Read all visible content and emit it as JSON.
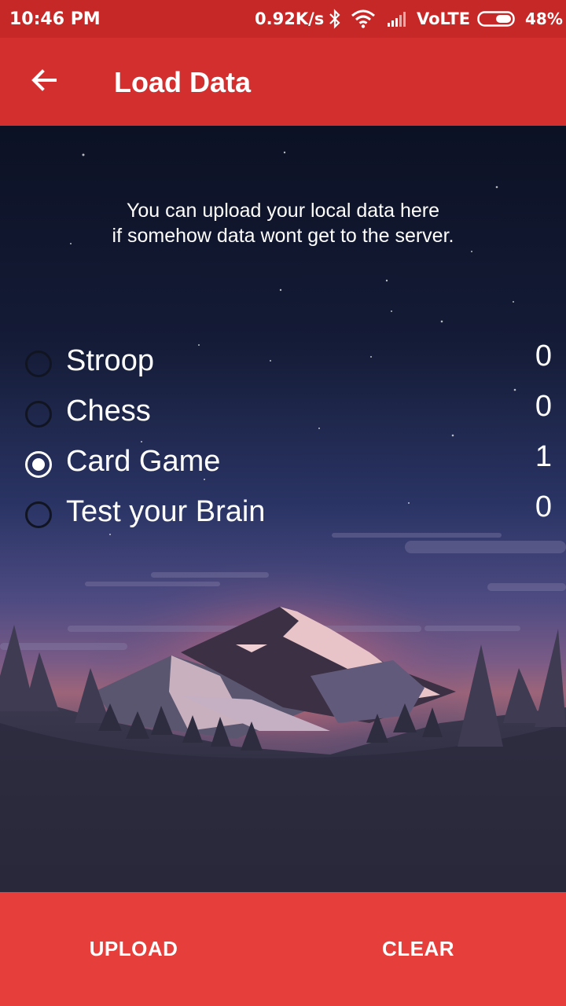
{
  "status_bar": {
    "time": "10:46 PM",
    "speed": "0.92K/s",
    "network": "VoLTE",
    "battery": "48%",
    "icons": [
      "bluetooth-icon",
      "wifi-icon",
      "signal-icon",
      "battery-icon"
    ]
  },
  "app_bar": {
    "title": "Load Data",
    "back_icon": "arrow-back-icon",
    "color": "#d32f2f"
  },
  "info": {
    "line1": "You can upload your local data here",
    "line2": "if somehow data wont get to the server."
  },
  "games": [
    {
      "label": "Stroop",
      "count": "0",
      "selected": false
    },
    {
      "label": "Chess",
      "count": "0",
      "selected": false
    },
    {
      "label": "Card Game",
      "count": "1",
      "selected": true
    },
    {
      "label": "Test your Brain",
      "count": "0",
      "selected": false
    }
  ],
  "actions": {
    "upload": "UPLOAD",
    "clear": "CLEAR",
    "color": "#e53e3b"
  }
}
